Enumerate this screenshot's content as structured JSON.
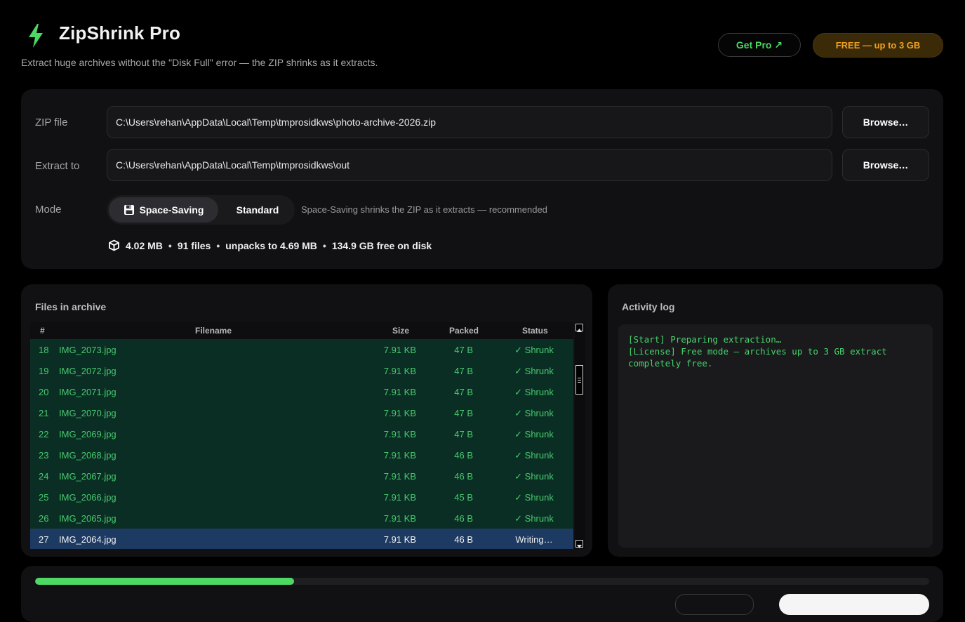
{
  "app": {
    "title": "ZipShrink Pro",
    "subtitle": "Extract huge archives without the \"Disk Full\" error — the ZIP shrinks as it extracts.",
    "get_pro_label": "Get Pro ↗",
    "plan_badge": "FREE — up to 3 GB",
    "accent_color": "#4cd964",
    "badge_color": "#f0a020"
  },
  "settings": {
    "zip_label": "ZIP file",
    "zip_path": "C:\\Users\\rehan\\AppData\\Local\\Temp\\tmprosidkws\\photo-archive-2026.zip",
    "extract_label": "Extract to",
    "extract_path": "C:\\Users\\rehan\\AppData\\Local\\Temp\\tmprosidkws\\out",
    "browse_label": "Browse…",
    "mode_label": "Mode",
    "mode_options": [
      "Space-Saving",
      "Standard"
    ],
    "mode_selected": "Space-Saving",
    "mode_hint": "Space-Saving shrinks the ZIP as it extracts — recommended",
    "stats": {
      "size": "4.02 MB",
      "files": "91 files",
      "unpacked": "unpacks to 4.69 MB",
      "free": "134.9 GB free on disk"
    }
  },
  "files": {
    "title": "Files in archive",
    "columns": [
      "#",
      "Filename",
      "Size",
      "Packed",
      "Status"
    ],
    "rows": [
      {
        "num": "18",
        "name": "IMG_2073.jpg",
        "size": "7.91 KB",
        "packed": "47 B",
        "status": "✓ Shrunk",
        "state": "done"
      },
      {
        "num": "19",
        "name": "IMG_2072.jpg",
        "size": "7.91 KB",
        "packed": "47 B",
        "status": "✓ Shrunk",
        "state": "done"
      },
      {
        "num": "20",
        "name": "IMG_2071.jpg",
        "size": "7.91 KB",
        "packed": "47 B",
        "status": "✓ Shrunk",
        "state": "done"
      },
      {
        "num": "21",
        "name": "IMG_2070.jpg",
        "size": "7.91 KB",
        "packed": "47 B",
        "status": "✓ Shrunk",
        "state": "done"
      },
      {
        "num": "22",
        "name": "IMG_2069.jpg",
        "size": "7.91 KB",
        "packed": "47 B",
        "status": "✓ Shrunk",
        "state": "done"
      },
      {
        "num": "23",
        "name": "IMG_2068.jpg",
        "size": "7.91 KB",
        "packed": "46 B",
        "status": "✓ Shrunk",
        "state": "done"
      },
      {
        "num": "24",
        "name": "IMG_2067.jpg",
        "size": "7.91 KB",
        "packed": "46 B",
        "status": "✓ Shrunk",
        "state": "done"
      },
      {
        "num": "25",
        "name": "IMG_2066.jpg",
        "size": "7.91 KB",
        "packed": "45 B",
        "status": "✓ Shrunk",
        "state": "done"
      },
      {
        "num": "26",
        "name": "IMG_2065.jpg",
        "size": "7.91 KB",
        "packed": "46 B",
        "status": "✓ Shrunk",
        "state": "done"
      },
      {
        "num": "27",
        "name": "IMG_2064.jpg",
        "size": "7.91 KB",
        "packed": "46 B",
        "status": "Writing…",
        "state": "active"
      }
    ]
  },
  "log": {
    "title": "Activity log",
    "lines": [
      "[Start] Preparing extraction…",
      "[License] Free mode — archives up to 3 GB extract completely free."
    ]
  },
  "progress": {
    "fraction": 0.29
  }
}
